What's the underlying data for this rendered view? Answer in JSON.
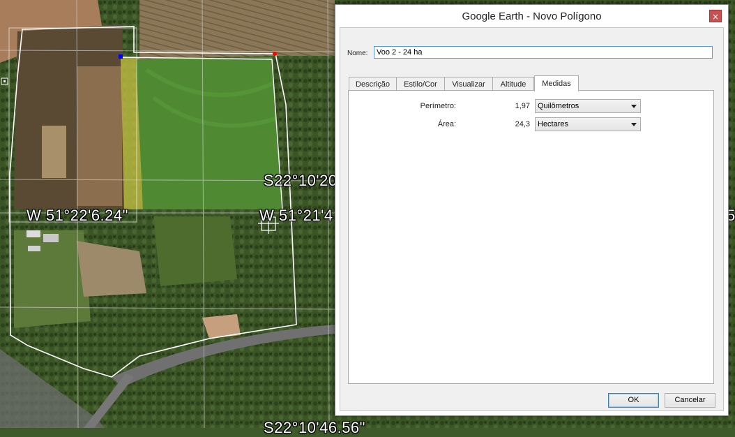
{
  "map": {
    "labels": {
      "lon_left": "W 51°22'6.24\"",
      "lat_mid": "S22°10'20",
      "lon_mid": "W 51°21'4",
      "lat_bottom": "S22°10'46.56\"",
      "right_edge": "5"
    },
    "colors": {
      "polygon_line": "#ffffff",
      "vertex_selected": "#0000ff",
      "vertex": "#ff0000"
    }
  },
  "dialog": {
    "title": "Google Earth - Novo Polígono",
    "close_glyph": "×",
    "name_label": "Nome:",
    "name_value": "Voo 2 - 24 ha",
    "tabs": [
      {
        "label": "Descrição"
      },
      {
        "label": "Estilo/Cor"
      },
      {
        "label": "Visualizar"
      },
      {
        "label": "Altitude"
      },
      {
        "label": "Medidas"
      }
    ],
    "active_tab": "Medidas",
    "measures": {
      "perimeter_label": "Perímetro:",
      "perimeter_value": "1,97",
      "perimeter_unit": "Quilômetros",
      "area_label": "Área:",
      "area_value": "24,3",
      "area_unit": "Hectares"
    },
    "ok_label": "OK",
    "cancel_label": "Cancelar"
  }
}
